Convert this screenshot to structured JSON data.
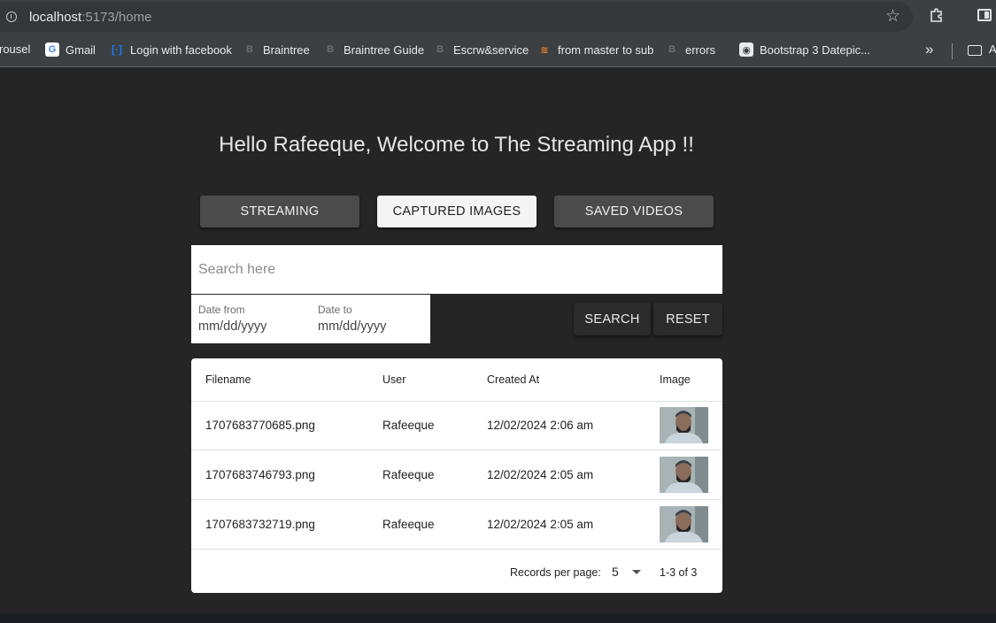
{
  "browser": {
    "url_host": "localhost",
    "url_path": ":5173/home",
    "bookmarks": [
      {
        "label": "rousel",
        "icon": "none"
      },
      {
        "label": "Gmail",
        "icon": "google-icon",
        "glyph": "G"
      },
      {
        "label": "Login with facebook",
        "icon": "facebook-icon",
        "glyph": "[·]"
      },
      {
        "label": "Braintree",
        "icon": "b-icon",
        "glyph": "B"
      },
      {
        "label": "Braintree Guide",
        "icon": "b-icon",
        "glyph": "B"
      },
      {
        "label": "Escrw&service",
        "icon": "b-icon",
        "glyph": "B"
      },
      {
        "label": "from master to sub",
        "icon": "stackoverflow-icon",
        "glyph": "≋"
      },
      {
        "label": "errors",
        "icon": "b-icon",
        "glyph": "B"
      },
      {
        "label": "Bootstrap 3 Datepic...",
        "icon": "globe-icon",
        "glyph": "◉"
      }
    ],
    "bookmarks_more": "»",
    "bookmark_last": "A"
  },
  "app": {
    "welcome": "Hello Rafeeque, Welcome to The Streaming App !!",
    "tabs": [
      {
        "label": "STREAMING",
        "active": false
      },
      {
        "label": "CAPTURED IMAGES",
        "active": true
      },
      {
        "label": "SAVED VIDEOS",
        "active": false
      }
    ],
    "search": {
      "placeholder": "Search here",
      "value": ""
    },
    "date_from": {
      "label": "Date from",
      "value": "mm/dd/yyyy"
    },
    "date_to": {
      "label": "Date to",
      "value": "mm/dd/yyyy"
    },
    "search_button": "SEARCH",
    "reset_button": "RESET"
  },
  "table": {
    "columns": [
      "Filename",
      "User",
      "Created At",
      "Image"
    ],
    "rows": [
      {
        "filename": "1707683770685.png",
        "user": "Rafeeque",
        "created_at": "12/02/2024 2:06 am"
      },
      {
        "filename": "1707683746793.png",
        "user": "Rafeeque",
        "created_at": "12/02/2024 2:05 am"
      },
      {
        "filename": "1707683732719.png",
        "user": "Rafeeque",
        "created_at": "12/02/2024 2:05 am"
      }
    ],
    "footer": {
      "records_per_page_label": "Records per page:",
      "records_per_page_value": "5",
      "range": "1-3 of 3"
    }
  },
  "colors": {
    "page_bg": "#252525",
    "chrome_bg": "#3c4043",
    "active_tab_bg": "#f4f4f4",
    "inactive_tab_bg": "#4b4b4b"
  }
}
